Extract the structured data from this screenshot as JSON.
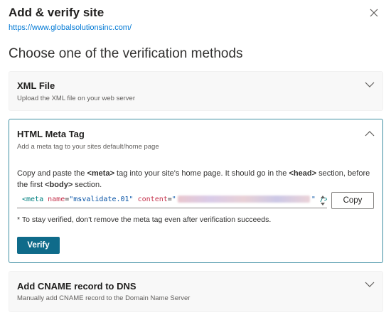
{
  "dialog": {
    "title": "Add & verify site",
    "site_url": "https://www.globalsolutionsinc.com/",
    "heading": "Choose one of the verification methods"
  },
  "methods": [
    {
      "title": "XML File",
      "subtitle": "Upload the XML file on your web server",
      "expanded": false
    },
    {
      "title": "HTML Meta Tag",
      "subtitle": "Add a meta tag to your sites default/home page",
      "expanded": true,
      "instructions": {
        "part1": "Copy and paste the ",
        "tag1": "<meta>",
        "part2": " tag into your site's home page. It should go in the ",
        "tag2": "<head>",
        "part3": " section, before the first ",
        "tag3": "<body>",
        "part4": " section."
      },
      "code": {
        "open": "<meta",
        "attr_name": "name",
        "eq1": "=",
        "name_value": "\"msvalidate.01\"",
        "attr_content": "content",
        "eq2": "=",
        "quote_open": "\"",
        "quote_close": "\"",
        "close": " />"
      },
      "copy_label": "Copy",
      "note": "* To stay verified, don't remove the meta tag even after verification succeeds.",
      "verify_label": "Verify"
    },
    {
      "title": "Add CNAME record to DNS",
      "subtitle": "Manually add CNAME record to the Domain Name Server",
      "expanded": false
    }
  ],
  "icons": {
    "close": "close-icon",
    "chevron_down": "chevron-down-icon",
    "chevron_up": "chevron-up-icon"
  },
  "colors": {
    "accent_button": "#0f6b8a",
    "link": "#0078d4",
    "active_border": "#3f8fa3"
  }
}
